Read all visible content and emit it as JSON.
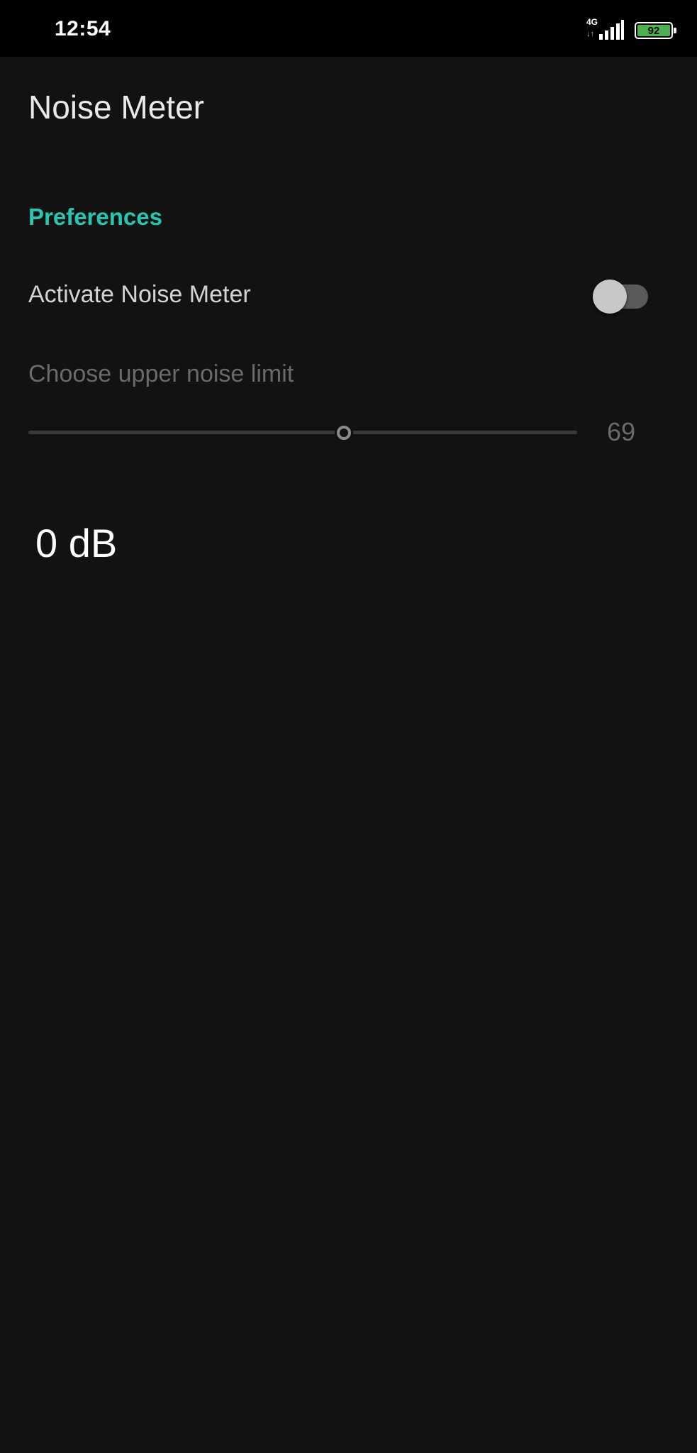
{
  "status_bar": {
    "time": "12:54",
    "network_type": "4G",
    "network_arrows": "↓↑",
    "signal_icon": "signal-bars-icon",
    "battery_level": "92",
    "battery_color": "#4caf50"
  },
  "app_bar": {
    "title": "Noise Meter"
  },
  "preferences": {
    "section_title": "Preferences",
    "section_color": "#26c6b0",
    "activate": {
      "label": "Activate Noise Meter",
      "enabled": false
    },
    "noise_limit": {
      "label": "Choose upper noise limit",
      "value": "69",
      "slider_fraction": 0.5745
    }
  },
  "reading": {
    "text": "0 dB"
  }
}
